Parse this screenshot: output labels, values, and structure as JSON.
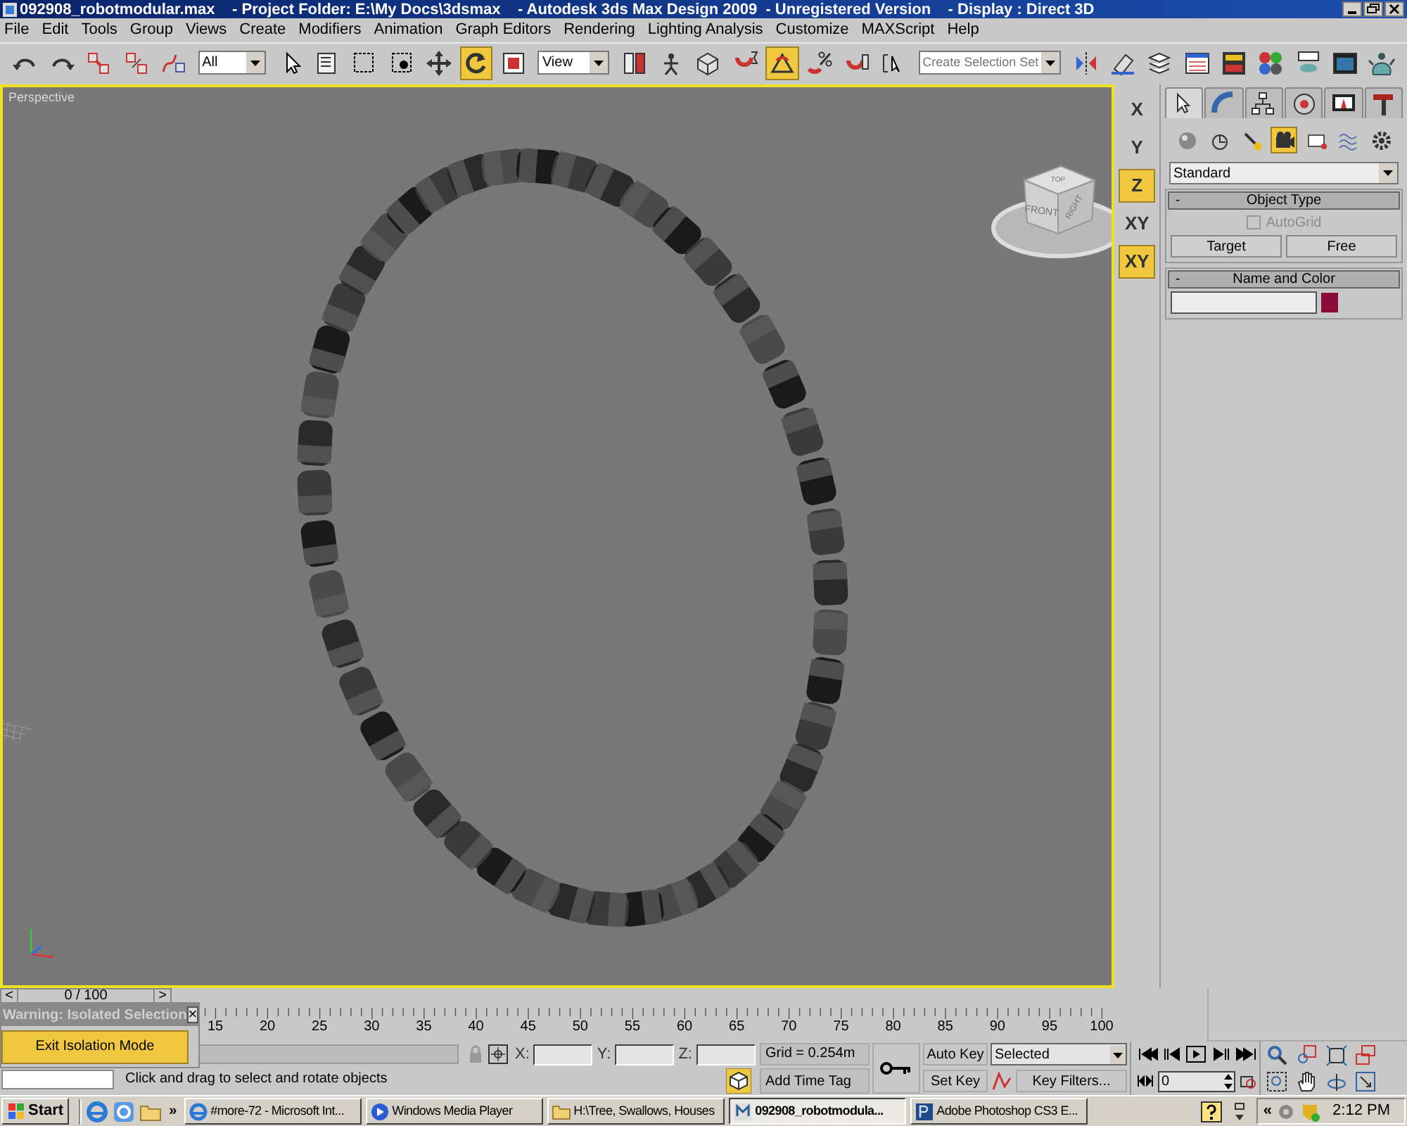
{
  "window": {
    "title": "092908_robotmodular.max    - Project Folder: E:\\My Docs\\3dsmax    - Autodesk 3ds Max Design 2009  - Unregistered Version    - Display : Direct 3D"
  },
  "menu": [
    "File",
    "Edit",
    "Tools",
    "Group",
    "Views",
    "Create",
    "Modifiers",
    "Animation",
    "Graph Editors",
    "Rendering",
    "Lighting Analysis",
    "Customize",
    "MAXScript",
    "Help"
  ],
  "toolbar": [
    {
      "kind": "button",
      "selected": false
    },
    {
      "kind": "button",
      "selected": false
    },
    {
      "kind": "button",
      "selected": false
    },
    {
      "kind": "button",
      "selected": false
    },
    {
      "kind": "button",
      "selected": false
    },
    {
      "kind": "dropdown",
      "value": "All"
    },
    {
      "kind": "button",
      "selected": false
    },
    {
      "kind": "button",
      "selected": false
    },
    {
      "kind": "button",
      "selected": false
    },
    {
      "kind": "button",
      "selected": false
    },
    {
      "kind": "button",
      "selected": false
    },
    {
      "kind": "button",
      "selected": true
    },
    {
      "kind": "button",
      "selected": false
    },
    {
      "kind": "dropdown",
      "value": "View"
    },
    {
      "kind": "button",
      "selected": false
    },
    {
      "kind": "button",
      "selected": false
    },
    {
      "kind": "button",
      "selected": false
    },
    {
      "kind": "button",
      "selected": false
    },
    {
      "kind": "button",
      "selected": true
    },
    {
      "kind": "button",
      "selected": false
    },
    {
      "kind": "button",
      "selected": false
    },
    {
      "kind": "button",
      "selected": false
    },
    {
      "kind": "dropdown",
      "value": "Create Selection Set"
    },
    {
      "kind": "button",
      "selected": false
    },
    {
      "kind": "button",
      "selected": false
    },
    {
      "kind": "button",
      "selected": false
    },
    {
      "kind": "button",
      "selected": false
    },
    {
      "kind": "button",
      "selected": false
    },
    {
      "kind": "button",
      "selected": false
    },
    {
      "kind": "button",
      "selected": false
    },
    {
      "kind": "button",
      "selected": false
    },
    {
      "kind": "button",
      "selected": false
    }
  ],
  "viewport": {
    "label": "Perspective",
    "viewcube": [
      "TOP",
      "FRONT",
      "RIGHT"
    ]
  },
  "axis_constraints": [
    {
      "label": "X",
      "selected": false
    },
    {
      "label": "Y",
      "selected": false
    },
    {
      "label": "Z",
      "selected": true
    },
    {
      "label": "XY",
      "selected": false
    },
    {
      "label": "XY",
      "selected": true
    }
  ],
  "command_panel": {
    "tabs": [
      {
        "selected": true
      },
      {
        "selected": false
      },
      {
        "selected": false
      },
      {
        "selected": false
      },
      {
        "selected": false
      },
      {
        "selected": false
      }
    ],
    "categories": [
      {
        "selected": false
      },
      {
        "selected": false
      },
      {
        "selected": false
      },
      {
        "selected": true
      },
      {
        "selected": false
      },
      {
        "selected": false
      },
      {
        "selected": false
      }
    ],
    "type_dropdown": "Standard",
    "object_type": {
      "title": "Object Type",
      "collapse": "-",
      "autogrid": {
        "label": "AutoGrid",
        "checked": false,
        "disabled": true
      },
      "buttons": [
        "Target",
        "Free"
      ]
    },
    "name_and_color": {
      "title": "Name and Color",
      "collapse": "-",
      "color": "#8b0a3a"
    }
  },
  "time_slider": {
    "prev": "<",
    "position": "0 / 100",
    "next": ">",
    "level": 0
  },
  "ruler_labels": [
    "15",
    "20",
    "25",
    "30",
    "35",
    "40",
    "45",
    "50",
    "55",
    "60",
    "65",
    "70",
    "75",
    "80",
    "85",
    "90",
    "95",
    "100"
  ],
  "isolation_popup": {
    "title": "Warning: Isolated Selection",
    "close": "×",
    "button": "Exit Isolation Mode"
  },
  "status": {
    "prompt": "Click and drag to select and rotate objects",
    "x_label": "X:",
    "y_label": "Y:",
    "z_label": "Z:",
    "grid": "Grid = 0.254m",
    "add_time_tag": "Add Time Tag",
    "auto_key": "Auto Key",
    "set_key": "Set Key",
    "key_mode": "Selected",
    "key_filters": "Key Filters...",
    "frame": "0"
  },
  "taskbar": {
    "start": "Start",
    "more": "»",
    "tasks": [
      {
        "label": "#more-72 - Microsoft Int...",
        "selected": false
      },
      {
        "label": "Windows Media Player",
        "selected": false
      },
      {
        "label": "H:\\Tree, Swallows, Houses",
        "selected": false
      },
      {
        "label": "092908_robotmodula...",
        "selected": true
      },
      {
        "label": "Adobe Photoshop CS3 E...",
        "selected": false
      }
    ],
    "tray_expand": "«",
    "clock": "2:12 PM"
  }
}
